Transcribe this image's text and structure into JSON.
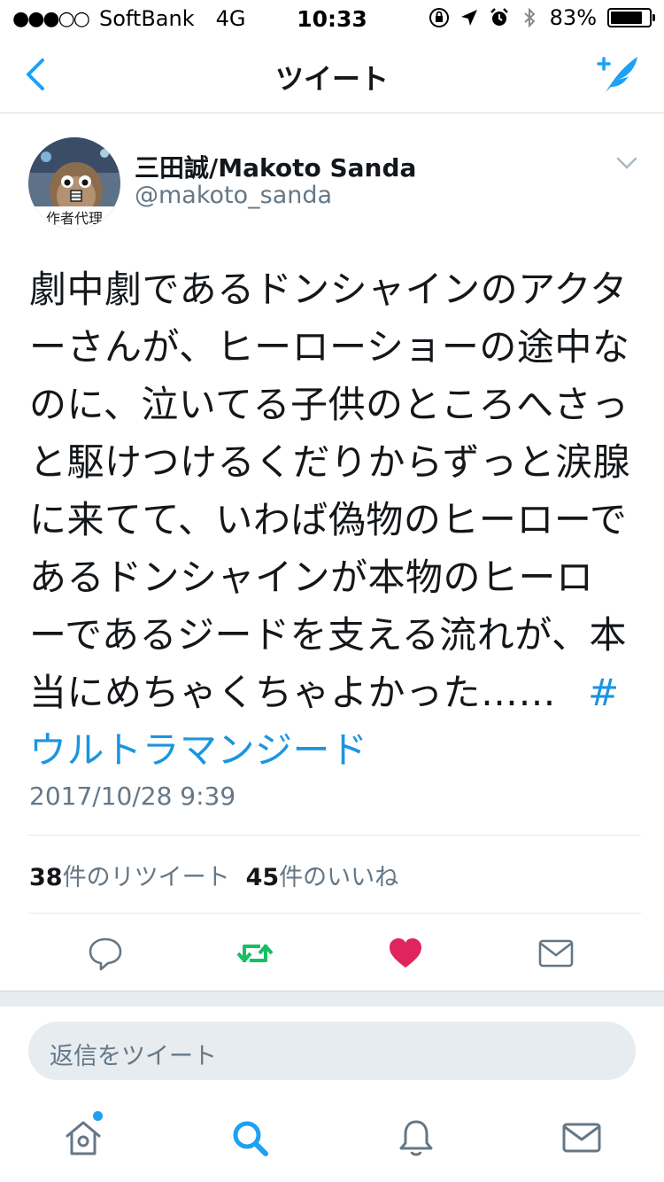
{
  "status_bar": {
    "signal_dots": "●●●○○",
    "carrier": "SoftBank",
    "network": "4G",
    "time": "10:33",
    "battery_percent": "83%",
    "battery_level": 0.83
  },
  "nav": {
    "title": "ツイート",
    "back_icon": "chevron-left-icon",
    "compose_icon": "compose-tweet-icon"
  },
  "tweet": {
    "author_name": "三田誠/Makoto Sanda",
    "author_handle": "@makoto_sanda",
    "avatar_caption": "作者代理",
    "text": "劇中劇であるドンシャインのアクターさんが、ヒーローショーの途中なのに、泣いてる子供のところへさっと駆けつけるくだりからずっと涙腺に来てて、いわば偽物のヒーローであるドンシャインが本物のヒーローであるジードを支える流れが、本当にめちゃくちゃよかった……",
    "hashtag": "#ウルトラマンジード",
    "timestamp": "2017/10/28 9:39",
    "retweets": {
      "count": "38",
      "label": "件のリツイート"
    },
    "likes": {
      "count": "45",
      "label": "件のいいね"
    },
    "liked": true
  },
  "reply": {
    "placeholder": "返信をツイート"
  },
  "tabbar": {
    "items": [
      "home-icon",
      "search-icon",
      "notifications-icon",
      "messages-icon"
    ],
    "active": "search-icon"
  },
  "colors": {
    "accent": "#1da1f2",
    "link": "#1b95e0",
    "retweet": "#17bf63",
    "like": "#e0245e",
    "secondary_text": "#657786"
  }
}
